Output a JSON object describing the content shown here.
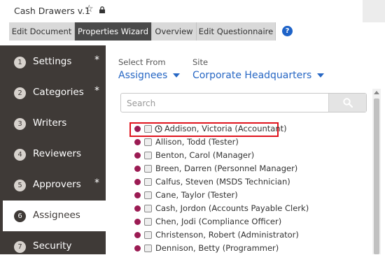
{
  "window": {
    "title": "Cash Drawers v.1",
    "star_icon": "star-outline-icon",
    "lock_icon": "lock-icon"
  },
  "tabs": [
    {
      "label": "Edit Document",
      "active": false
    },
    {
      "label": "Properties Wizard",
      "active": true
    },
    {
      "label": "Overview",
      "active": false
    },
    {
      "label": "Edit Questionnaire",
      "active": false
    }
  ],
  "help": {
    "icon": "help-icon",
    "glyph": "?",
    "color": "#1e63c8"
  },
  "sidebar": {
    "items": [
      {
        "num": "1",
        "label": "Settings",
        "required": "*"
      },
      {
        "num": "2",
        "label": "Categories",
        "required": "*"
      },
      {
        "num": "3",
        "label": "Writers",
        "required": ""
      },
      {
        "num": "4",
        "label": "Reviewers",
        "required": ""
      },
      {
        "num": "5",
        "label": "Approvers",
        "required": "*"
      },
      {
        "num": "6",
        "label": "Assignees",
        "required": "",
        "active": true
      },
      {
        "num": "7",
        "label": "Security",
        "required": ""
      }
    ]
  },
  "main": {
    "select_from": {
      "label": "Select From",
      "value": "Assignees"
    },
    "site": {
      "label": "Site",
      "value": "Corporate Headquarters"
    },
    "search": {
      "placeholder": "Search",
      "value": "",
      "icon": "search-icon"
    },
    "list": [
      {
        "name": "Addison, Victoria (Accountant)",
        "highlighted": true,
        "icon": "clock-icon"
      },
      {
        "name": "Allison, Todd (Tester)"
      },
      {
        "name": "Benton, Carol (Manager)"
      },
      {
        "name": "Breen, Darren (Personnel Manager)"
      },
      {
        "name": "Calfus, Steven (MSDS Technician)"
      },
      {
        "name": "Cane, Taylor (Tester)"
      },
      {
        "name": "Cash, Jordon (Accounts Payable Clerk)"
      },
      {
        "name": "Chen, Jodi (Compliance Officer)"
      },
      {
        "name": "Christenson, Robert (Administrator)"
      },
      {
        "name": "Dennison, Betty (Programmer)"
      }
    ]
  },
  "colors": {
    "accent": "#2767c4",
    "sidebar": "#3f3a37",
    "status_dot": "#9b1b53",
    "highlight": "#e0141e",
    "active_tab": "#4a4a4a"
  }
}
